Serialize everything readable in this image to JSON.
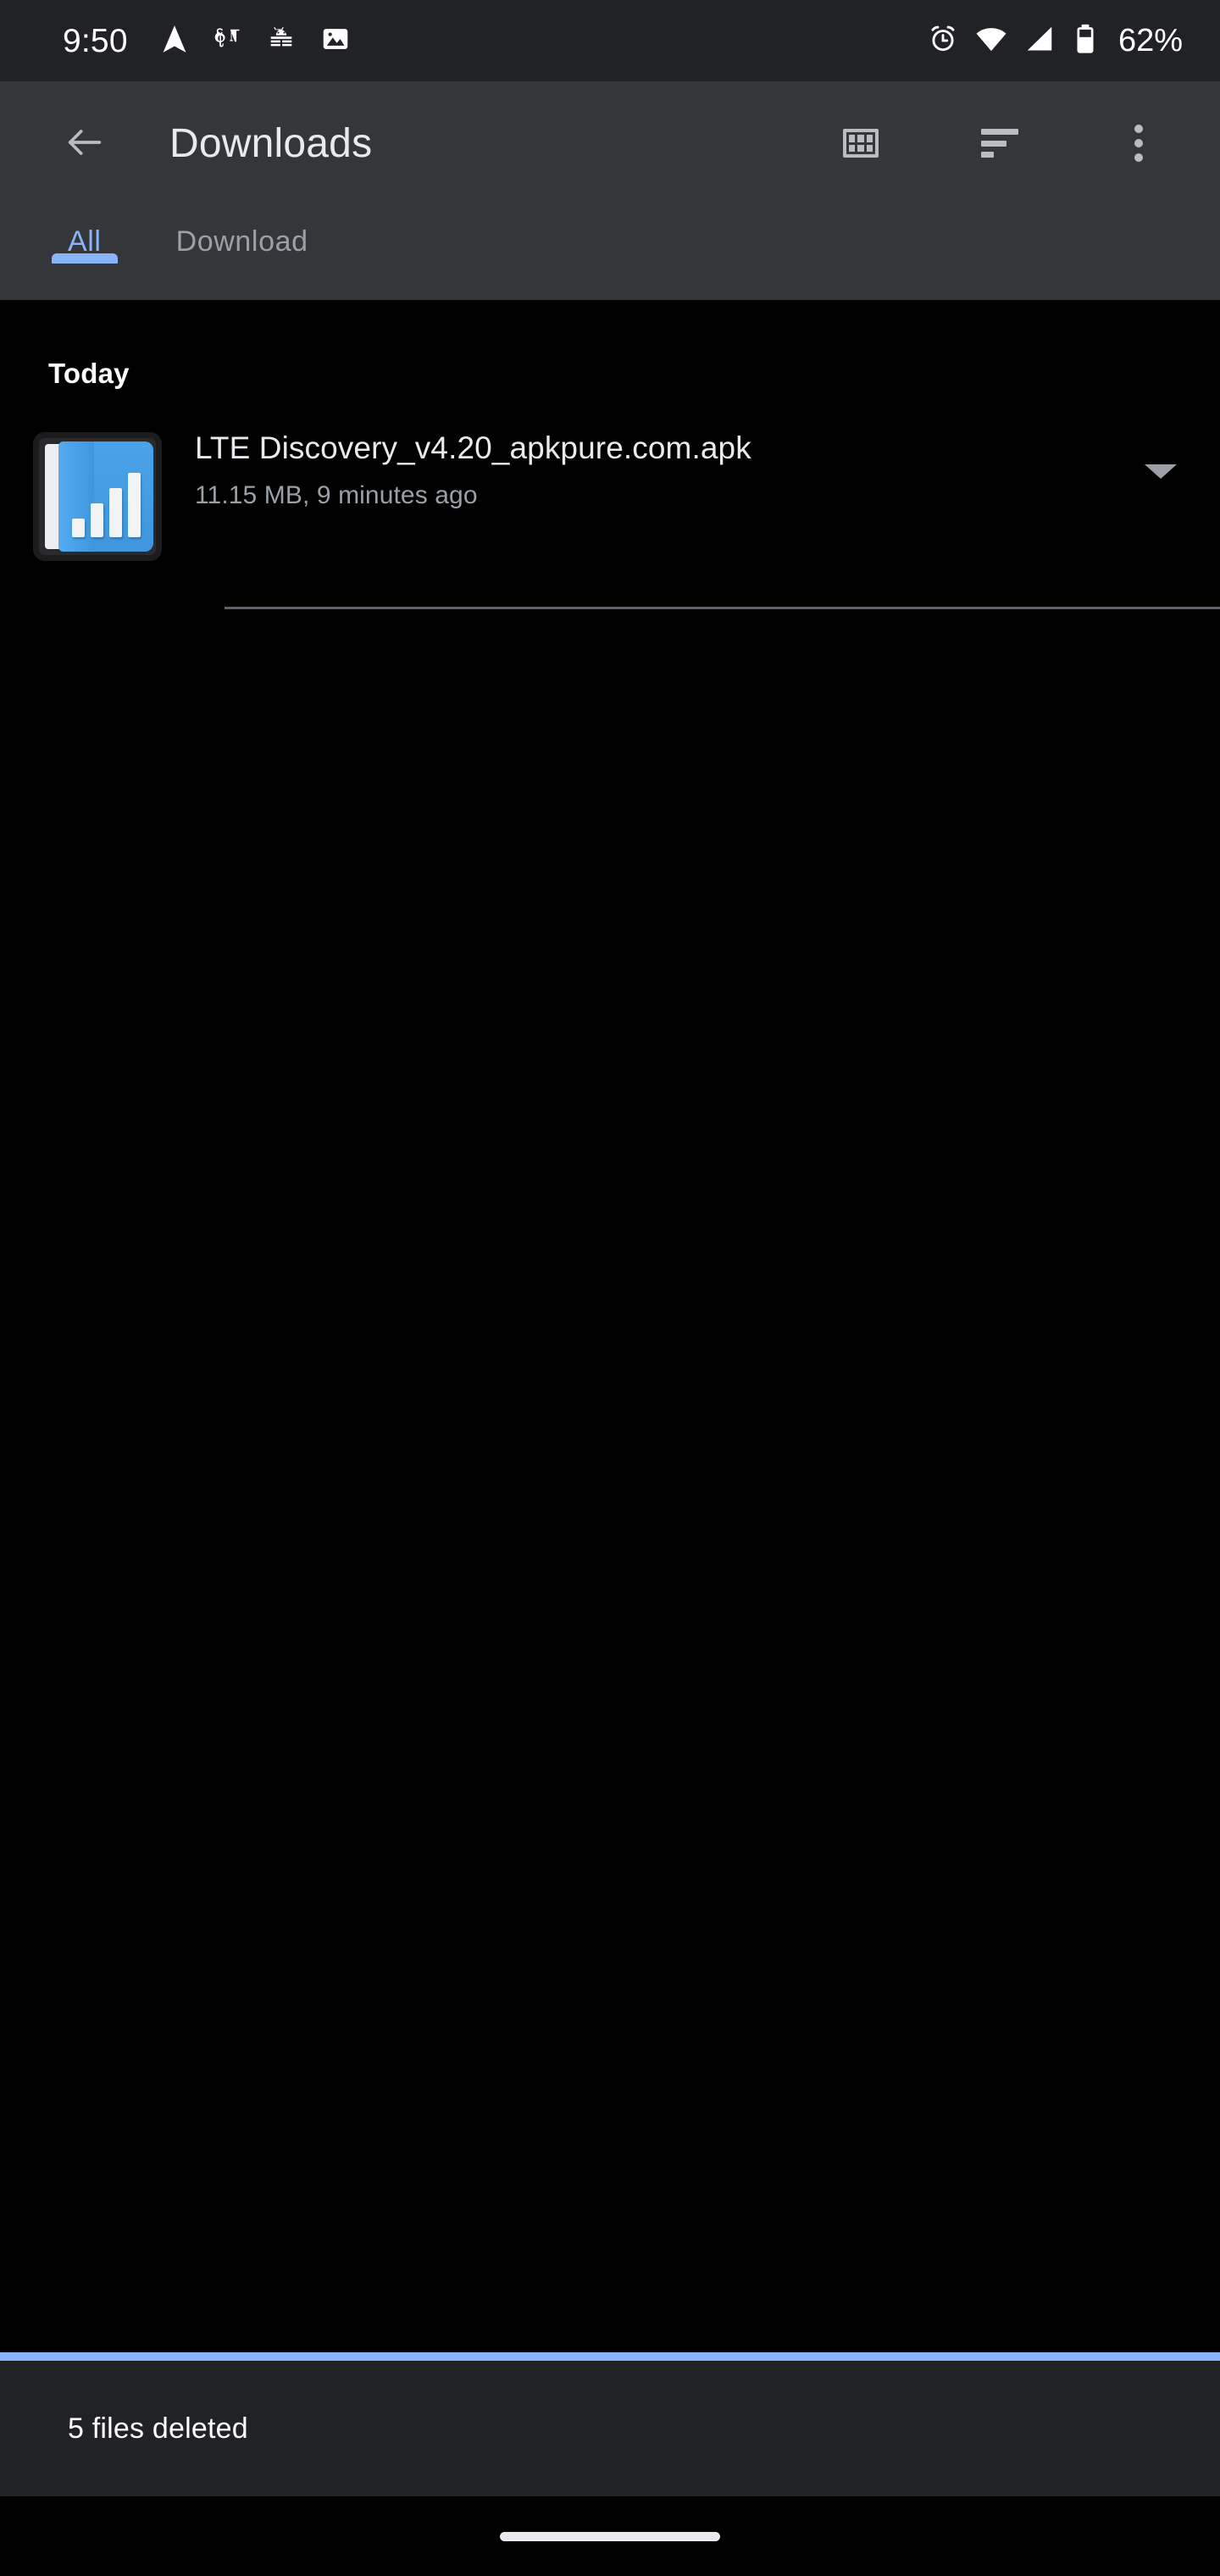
{
  "status_bar": {
    "time": "9:50",
    "battery_percent": "62%",
    "left_icons": [
      {
        "name": "navigation-arrow-icon",
        "label": "Navigation"
      },
      {
        "name": "nytimes-icon",
        "label": "The New York Times"
      },
      {
        "name": "android-bug-icon",
        "label": "Android"
      },
      {
        "name": "photo-icon",
        "label": "Photos"
      }
    ],
    "right_icons": [
      {
        "name": "alarm-icon",
        "label": "Alarm set"
      },
      {
        "name": "wifi-icon",
        "label": "Wi-Fi"
      },
      {
        "name": "cellular-signal-icon",
        "label": "Mobile signal"
      },
      {
        "name": "battery-icon",
        "label": "Battery"
      }
    ]
  },
  "app_bar": {
    "back_label": "Back",
    "title": "Downloads",
    "actions": [
      {
        "name": "grid-view-icon",
        "label": "Grid view"
      },
      {
        "name": "sort-icon",
        "label": "Sort by"
      },
      {
        "name": "overflow-menu-icon",
        "label": "More options"
      }
    ]
  },
  "tabs": [
    {
      "label": "All",
      "active": true
    },
    {
      "label": "Download",
      "active": false
    }
  ],
  "content": {
    "section_header": "Today",
    "files": [
      {
        "name": "LTE Discovery_v4.20_apkpure.com.apk",
        "meta": "11.15 MB, 9 minutes ago",
        "size": "11.15 MB",
        "time": "9 minutes ago",
        "icon": "apk-chart-icon",
        "expand_label": "Expand"
      }
    ]
  },
  "snackbar": {
    "message": "5 files deleted"
  },
  "navigation_bar": {
    "pill_label": "Home gesture bar"
  },
  "colors": {
    "status_bar_bg": "#212225",
    "app_bar_bg": "#35363a",
    "content_bg": "#000000",
    "accent": "#8ab4f8",
    "primary_text": "#e8eaed",
    "secondary_text": "#9aa0a6",
    "divider": "#5f6368"
  }
}
